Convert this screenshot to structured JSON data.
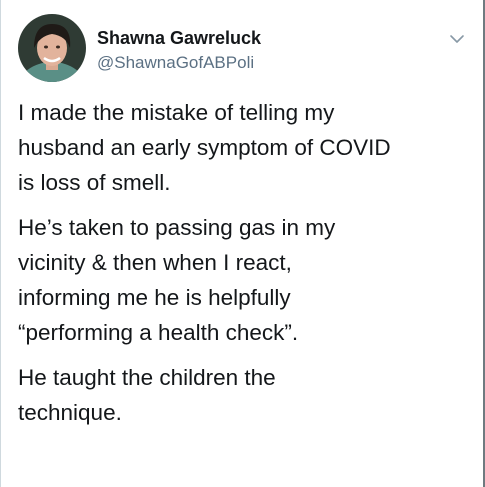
{
  "tweet": {
    "author_name": "Shawna Gawreluck",
    "author_handle": "@ShawnaGofABPoli",
    "paragraphs": [
      [
        "I made the mistake of telling my",
        "husband an early symptom of COVID",
        "is loss of smell."
      ],
      [
        "He’s taken to passing gas in my",
        "vicinity & then when I react,",
        "informing me he is helpfully",
        "“performing a health check”."
      ],
      [
        "He taught the children the",
        "technique."
      ]
    ]
  },
  "icons": {
    "avatar": "profile-photo",
    "menu": "chevron-down-icon"
  },
  "colors": {
    "text": "#14171a",
    "secondary_text": "#5b7083",
    "chevron": "#8899a6"
  }
}
